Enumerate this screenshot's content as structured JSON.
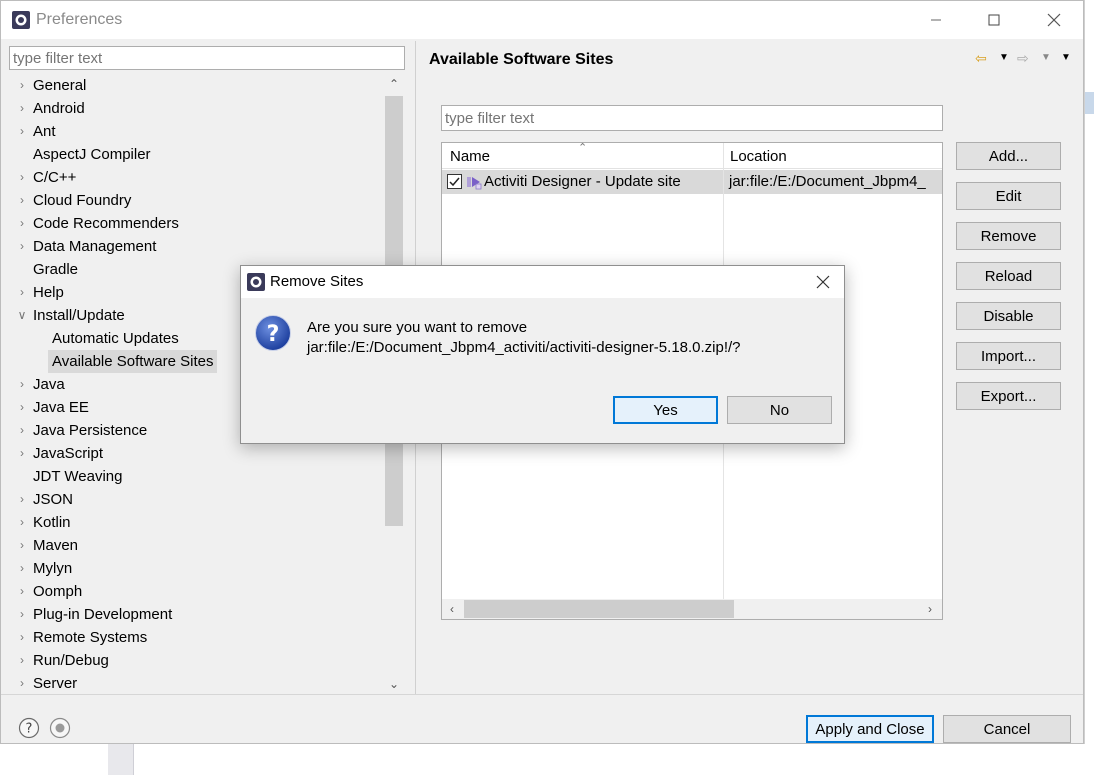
{
  "window": {
    "title": "Preferences"
  },
  "left": {
    "filter_placeholder": "type filter text",
    "tree": [
      {
        "label": "General",
        "expandable": true,
        "indent": 0
      },
      {
        "label": "Android",
        "expandable": true,
        "indent": 0
      },
      {
        "label": "Ant",
        "expandable": true,
        "indent": 0
      },
      {
        "label": "AspectJ Compiler",
        "expandable": false,
        "indent": 0
      },
      {
        "label": "C/C++",
        "expandable": true,
        "indent": 0
      },
      {
        "label": "Cloud Foundry",
        "expandable": true,
        "indent": 0
      },
      {
        "label": "Code Recommenders",
        "expandable": true,
        "indent": 0
      },
      {
        "label": "Data Management",
        "expandable": true,
        "indent": 0
      },
      {
        "label": "Gradle",
        "expandable": false,
        "indent": 0
      },
      {
        "label": "Help",
        "expandable": true,
        "indent": 0
      },
      {
        "label": "Install/Update",
        "expandable": true,
        "expanded": true,
        "indent": 0
      },
      {
        "label": "Automatic Updates",
        "expandable": false,
        "indent": 1
      },
      {
        "label": "Available Software Sites",
        "expandable": false,
        "indent": 1,
        "selected": true
      },
      {
        "label": "Java",
        "expandable": true,
        "indent": 0
      },
      {
        "label": "Java EE",
        "expandable": true,
        "indent": 0
      },
      {
        "label": "Java Persistence",
        "expandable": true,
        "indent": 0
      },
      {
        "label": "JavaScript",
        "expandable": true,
        "indent": 0
      },
      {
        "label": "JDT Weaving",
        "expandable": false,
        "indent": 0
      },
      {
        "label": "JSON",
        "expandable": true,
        "indent": 0
      },
      {
        "label": "Kotlin",
        "expandable": true,
        "indent": 0
      },
      {
        "label": "Maven",
        "expandable": true,
        "indent": 0
      },
      {
        "label": "Mylyn",
        "expandable": true,
        "indent": 0
      },
      {
        "label": "Oomph",
        "expandable": true,
        "indent": 0
      },
      {
        "label": "Plug-in Development",
        "expandable": true,
        "indent": 0
      },
      {
        "label": "Remote Systems",
        "expandable": true,
        "indent": 0
      },
      {
        "label": "Run/Debug",
        "expandable": true,
        "indent": 0
      },
      {
        "label": "Server",
        "expandable": true,
        "indent": 0
      }
    ]
  },
  "right": {
    "page_title": "Available Software Sites",
    "filter_placeholder": "type filter text",
    "table": {
      "columns": [
        "Name",
        "Location"
      ],
      "rows": [
        {
          "checked": true,
          "name": "Activiti Designer - Update site",
          "location": "jar:file:/E:/Document_Jbpm4_"
        }
      ]
    },
    "buttons": [
      "Add...",
      "Edit",
      "Remove",
      "Reload",
      "Disable",
      "Import...",
      "Export..."
    ]
  },
  "footer": {
    "apply_close": "Apply and Close",
    "cancel": "Cancel"
  },
  "dialog": {
    "title": "Remove Sites",
    "message_line1": "Are you sure you want to remove",
    "message_line2": "jar:file:/E:/Document_Jbpm4_activiti/activiti-designer-5.18.0.zip!/?",
    "yes": "Yes",
    "no": "No"
  },
  "colors": {
    "accent": "#0078d7",
    "selection": "#d9d9d9",
    "window_bg": "#f0f0f0"
  }
}
